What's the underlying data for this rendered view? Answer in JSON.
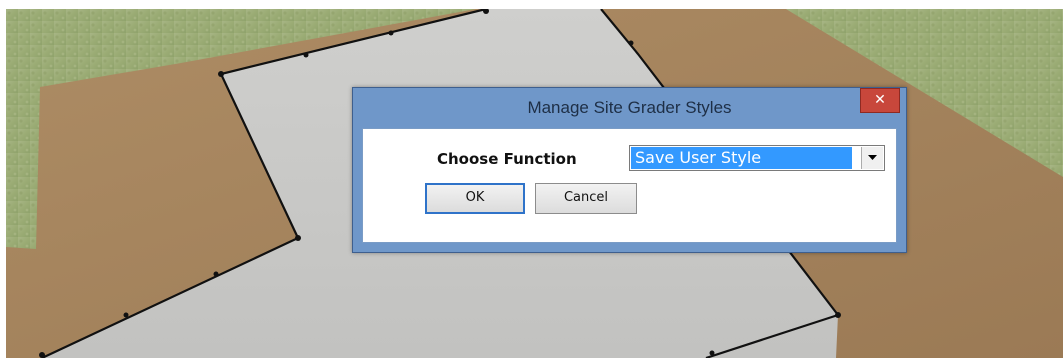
{
  "dialog": {
    "title": "Manage Site Grader Styles",
    "close_glyph": "✕",
    "choose_label": "Choose Function",
    "select_value": "Save User Style",
    "ok_label": "OK",
    "cancel_label": "Cancel"
  },
  "icons": {
    "close": "close-icon",
    "dropdown": "chevron-down-icon"
  },
  "colors": {
    "grass": "#9fae7a",
    "dirt": "#a4825c",
    "slab": "#c8c8c6",
    "outline": "#111111",
    "dialog_frame": "#6f97c9",
    "close_button": "#c8473b",
    "selection": "#3399ff"
  }
}
